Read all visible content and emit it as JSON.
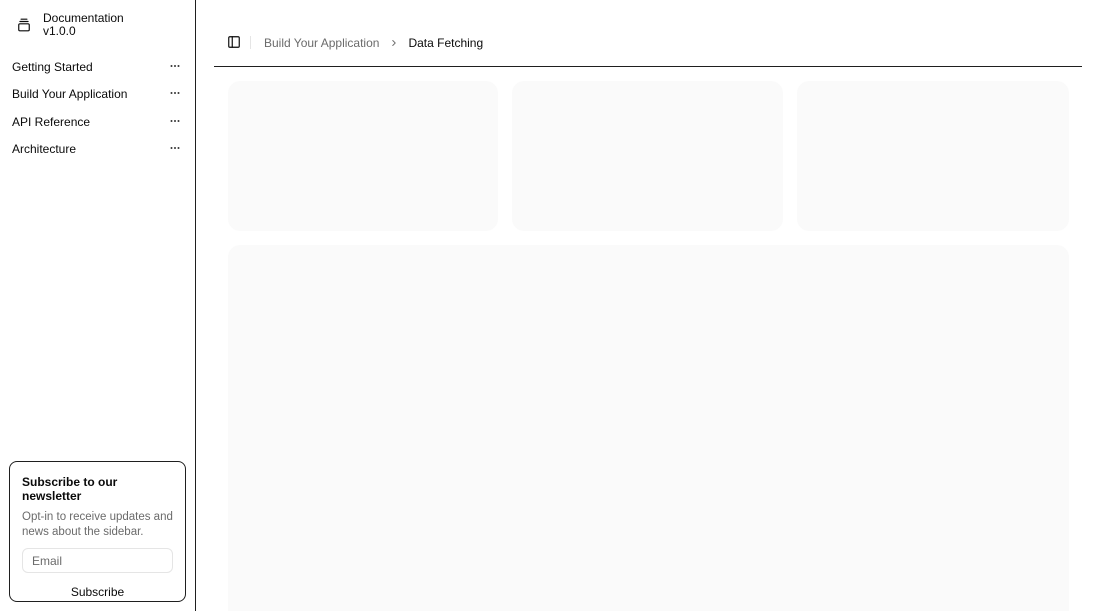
{
  "sidebar": {
    "brand": {
      "title": "Documentation",
      "version": "v1.0.0",
      "icon": "gallery-vertical-end-icon"
    },
    "items": [
      {
        "label": "Getting Started",
        "more_icon": "ellipsis-icon"
      },
      {
        "label": "Build Your Application",
        "more_icon": "ellipsis-icon"
      },
      {
        "label": "API Reference",
        "more_icon": "ellipsis-icon"
      },
      {
        "label": "Architecture",
        "more_icon": "ellipsis-icon"
      }
    ],
    "newsletter": {
      "title": "Subscribe to our newsletter",
      "description": "Opt-in to receive updates and news about the sidebar.",
      "email_placeholder": "Email",
      "email_value": "",
      "button_label": "Subscribe"
    }
  },
  "header": {
    "toggle_icon": "panel-left-icon",
    "breadcrumb": {
      "parent": "Build Your Application",
      "current": "Data Fetching"
    }
  },
  "colors": {
    "border": "#1f1f1f",
    "muted_text": "#6b6b6b",
    "skeleton": "#fafafa"
  }
}
